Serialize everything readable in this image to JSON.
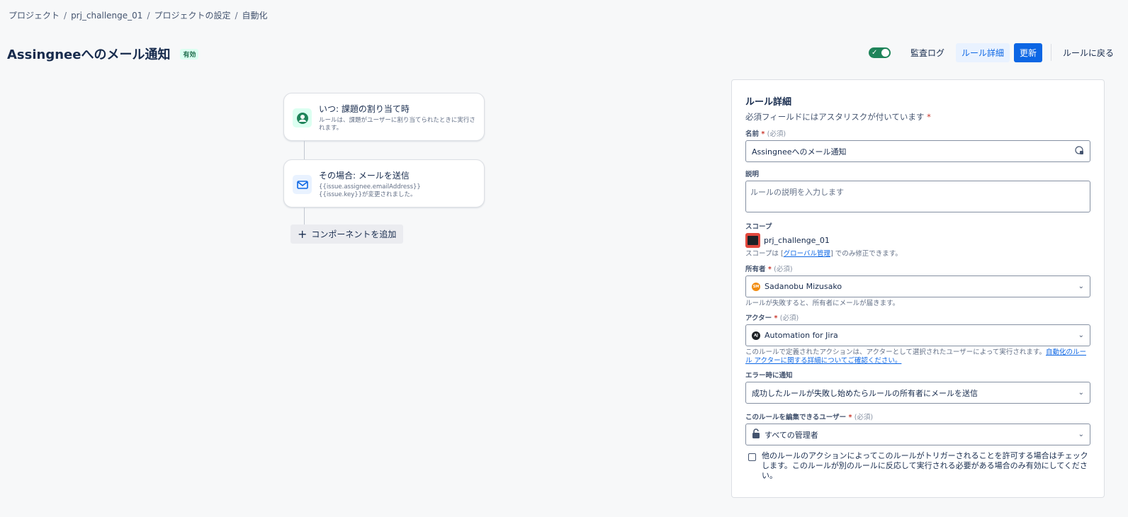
{
  "breadcrumb": [
    "プロジェクト",
    "prj_challenge_01",
    "プロジェクトの設定",
    "自動化"
  ],
  "breadcrumb_sep": "/",
  "rule": {
    "title": "Assingneeへのメール通知",
    "status": "有効"
  },
  "toolbar": {
    "enabled": true,
    "audit_log": "監査ログ",
    "rule_details": "ルール詳細",
    "update": "更新",
    "back": "ルールに戻る"
  },
  "flow": {
    "trigger": {
      "title": "いつ: 課題の割り当て時",
      "desc": "ルールは、課題がユーザーに割り当てられたときに実行されます。"
    },
    "action": {
      "title": "その場合: メールを送信",
      "line1": "{{issue.assignee.emailAddress}}",
      "line2": "{{issue.key}}が変更されました。"
    },
    "add_component": "コンポーネントを追加"
  },
  "panel": {
    "title": "ルール詳細",
    "required_note": "必須フィールドにはアスタリスクが付いています",
    "asterisk": "*",
    "optional_note": "(必須)",
    "name_label": "名前",
    "name_value": "Assingneeへのメール通知",
    "desc_label": "説明",
    "desc_placeholder": "ルールの説明を入力します",
    "scope_label": "スコープ",
    "scope_value": "prj_challenge_01",
    "scope_help_pre": "スコープは [",
    "scope_help_link": "グローバル管理",
    "scope_help_post": "] でのみ修正できます。",
    "owner_label": "所有者",
    "owner_initials": "SM",
    "owner_value": "Sadanobu Mizusako",
    "owner_help": "ルールが失敗すると、所有者にメールが届きます。",
    "actor_label": "アクター",
    "actor_initials": "AJ",
    "actor_value": "Automation for Jira",
    "actor_help": "このルールで定義されたアクションは、アクターとして選択されたユーザーによって実行されます。",
    "actor_help_link": "自動化のルール アクターに関する詳細についてご確認ください。",
    "error_label": "エラー時に通知",
    "error_value": "成功したルールが失敗し始めたらルールの所有者にメールを送信",
    "editors_label": "このルールを編集できるユーザー",
    "editors_value": "すべての管理者",
    "checkbox_text": "他のルールのアクションによってこのルールがトリガーされることを許可する場合はチェックします。このルールが別のルールに反応して実行される必要がある場合のみ有効にしてください。"
  }
}
